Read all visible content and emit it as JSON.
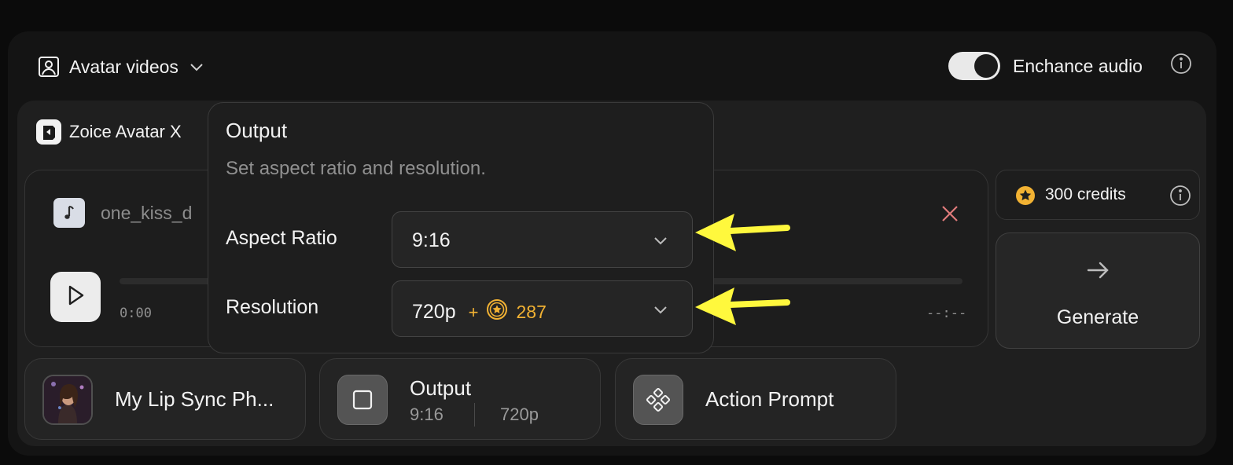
{
  "header": {
    "mode_label": "Avatar videos",
    "mode_icon": "portrait-icon",
    "enhance_audio_label": "Enchance audio",
    "enhance_audio_on": true
  },
  "model": {
    "name": "Zoice Avatar X"
  },
  "audio": {
    "file_name": "one_kiss_d",
    "time_start": "0:00",
    "time_end": "--:--"
  },
  "credits": {
    "amount": "300",
    "unit": "credits"
  },
  "generate": {
    "label": "Generate"
  },
  "bottom_pills": {
    "lip_sync": {
      "label": "My Lip Sync Ph..."
    },
    "output": {
      "title": "Output",
      "ratio": "9:16",
      "resolution": "720p"
    },
    "action_prompt": {
      "label": "Action Prompt"
    }
  },
  "popover": {
    "title": "Output",
    "subtitle": "Set aspect ratio and resolution.",
    "aspect_ratio": {
      "label": "Aspect Ratio",
      "value": "9:16"
    },
    "resolution": {
      "label": "Resolution",
      "value": "720p",
      "plus": "+",
      "extra_cost": "287"
    }
  },
  "colors": {
    "accent_gold": "#f2b233",
    "annotation_arrow": "#fff83d",
    "close_red": "#e07b7b"
  }
}
